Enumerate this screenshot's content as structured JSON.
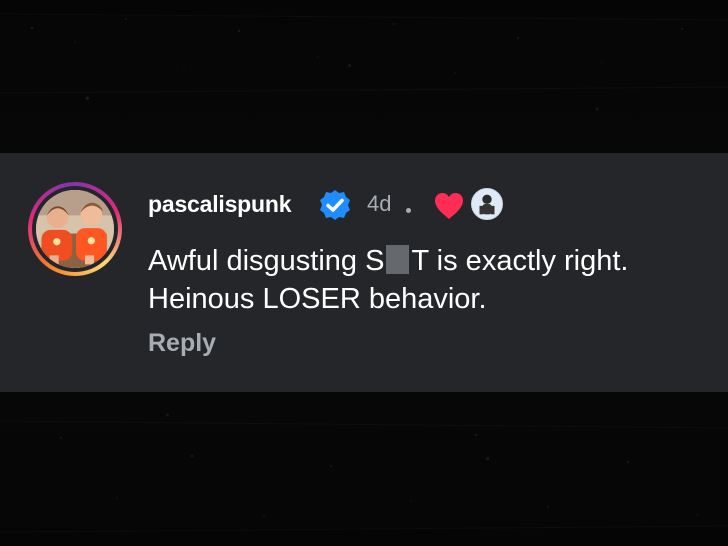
{
  "comment": {
    "username": "pascalispunk",
    "time_ago": "4d",
    "text_before_censor": "Awful disgusting S",
    "text_after_censor": "T is exactly right.",
    "text_line_2": "Heinous LOSER behavior.",
    "reply_label": "Reply"
  },
  "icons": {
    "verified": "verified-badge-icon",
    "heart": "heart-icon",
    "liker_avatar": "liker-avatar-icon"
  },
  "colors": {
    "card_background": "#242629",
    "username": "#ffffff",
    "meta_text": "#a8adb3",
    "verified_blue": "#1f8cff",
    "heart_red": "#ff2d55",
    "ring_gradient_start": "#f58529",
    "ring_gradient_mid": "#dd2a7b",
    "ring_gradient_end": "#8134af"
  }
}
